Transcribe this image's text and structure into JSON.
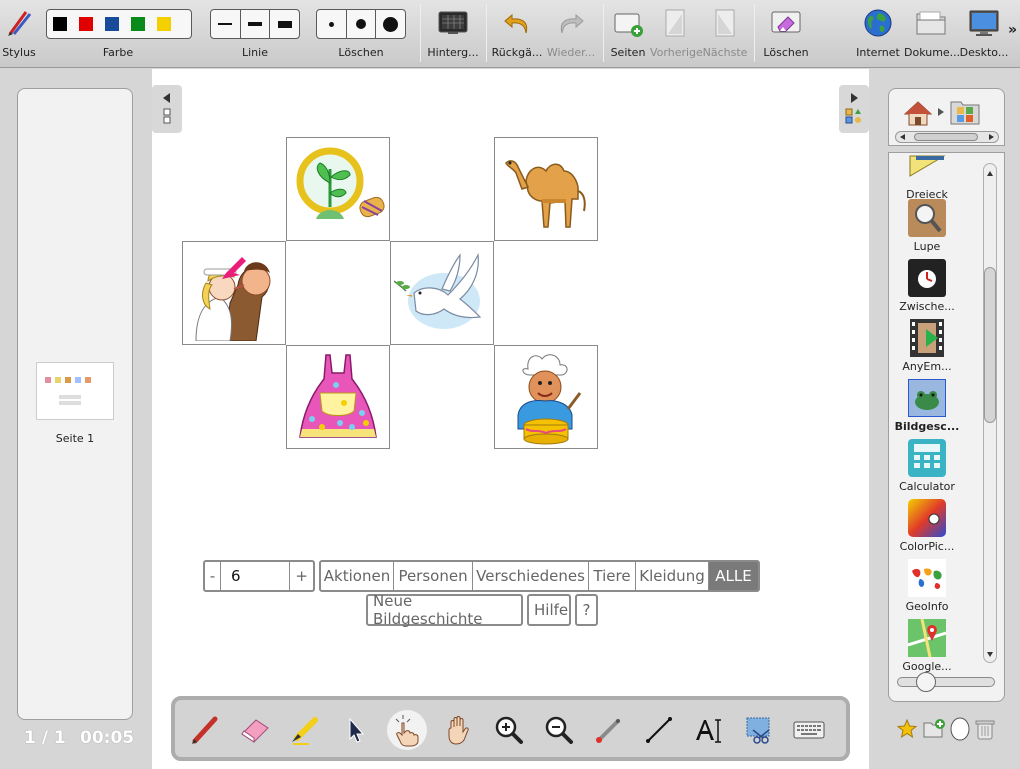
{
  "toolbar": {
    "stylus": "Stylus",
    "farbe": "Farbe",
    "linie": "Linie",
    "loeschen_size": "Löschen",
    "hintergrund": "Hinterg...",
    "rueckgaengig": "Rückgä...",
    "wiederholen": "Wieder...",
    "seiten": "Seiten",
    "vorherige": "Vorherige",
    "naechste": "Nächste",
    "loeschen": "Löschen",
    "internet": "Internet",
    "dokumente": "Dokume...",
    "desktop": "Deskto...",
    "more": "»",
    "colors": [
      "#000000",
      "#e00000",
      "#1a4a9a",
      "#0a8a1a",
      "#f4d000"
    ]
  },
  "left_panel": {
    "page_label": "Seite 1",
    "page_counter": "1 / 1",
    "timer": "00:05"
  },
  "controls": {
    "minus": "-",
    "count": "6",
    "plus": "+",
    "categories": [
      "Aktionen",
      "Personen",
      "Verschiedenes",
      "Tiere",
      "Kleidung",
      "ALLE"
    ],
    "new_story": "Neue Bildgeschichte",
    "help": "Hilfe",
    "question": "?"
  },
  "right_panel": {
    "apps": [
      "Dreieck",
      "Lupe",
      "Zwische...",
      "AnyEm...",
      "Bildgesc...",
      "Calculator",
      "ColorPic...",
      "GeoInfo",
      "Google..."
    ]
  },
  "icons": {
    "stylus": "pen-icon",
    "hintergrund": "background-icon",
    "undo": "undo-icon",
    "redo": "redo-icon",
    "pages": "add-page-icon",
    "prev": "prev-page-icon",
    "next": "next-page-icon",
    "clear": "eraser-icon",
    "internet": "globe-icon",
    "documents": "folder-icon",
    "desktop": "monitor-icon"
  }
}
